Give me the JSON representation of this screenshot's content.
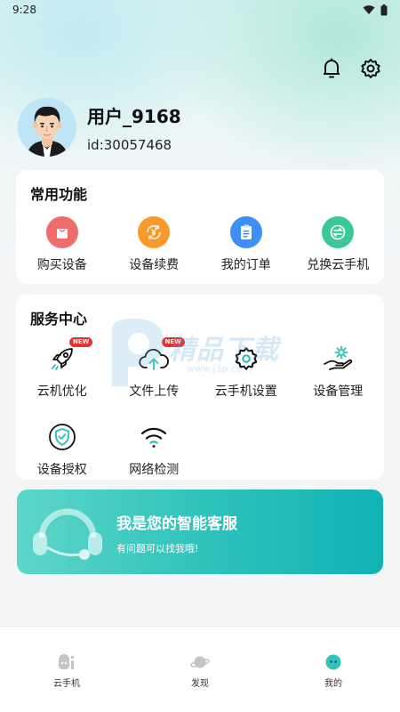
{
  "status_bar": {
    "time": "9:28"
  },
  "header": {
    "notification_icon": "bell-icon",
    "settings_icon": "gear-icon"
  },
  "profile": {
    "username": "用户_9168",
    "user_id": "id:30057468"
  },
  "common": {
    "title": "常用功能",
    "items": [
      {
        "label": "购买设备",
        "icon": "shopping-bag-icon",
        "color": "#f06b6b"
      },
      {
        "label": "设备续费",
        "icon": "yen-renew-icon",
        "color": "#f79a2a"
      },
      {
        "label": "我的订单",
        "icon": "clipboard-icon",
        "color": "#3d8ef5"
      },
      {
        "label": "兑换云手机",
        "icon": "exchange-icon",
        "color": "#3cc79a"
      }
    ]
  },
  "service": {
    "title": "服务中心",
    "badge": "NEW",
    "items": [
      {
        "label": "云机优化",
        "icon": "rocket-icon",
        "new": true
      },
      {
        "label": "文件上传",
        "icon": "cloud-upload-icon",
        "new": true
      },
      {
        "label": "云手机设置",
        "icon": "gear-outline-icon",
        "new": false
      },
      {
        "label": "设备管理",
        "icon": "hand-gear-icon",
        "new": false
      },
      {
        "label": "设备授权",
        "icon": "shield-check-icon",
        "new": false
      },
      {
        "label": "网络检测",
        "icon": "wifi-icon",
        "new": false
      }
    ]
  },
  "watermark": {
    "text": "精品下载",
    "sub": "www.j3p.com"
  },
  "banner": {
    "title": "我是您的智能客服",
    "subtitle": "有问题可以找我哦!",
    "colors": [
      "#5ed6c9",
      "#12b2b6"
    ]
  },
  "bottom_nav": [
    {
      "label": "云手机",
      "icon": "cloud-phone-icon",
      "active": false
    },
    {
      "label": "发现",
      "icon": "planet-icon",
      "active": false
    },
    {
      "label": "我的",
      "icon": "profile-face-icon",
      "active": true
    }
  ],
  "colors": {
    "accent": "#12b2b6",
    "nav_active": "#2fc3bb"
  }
}
